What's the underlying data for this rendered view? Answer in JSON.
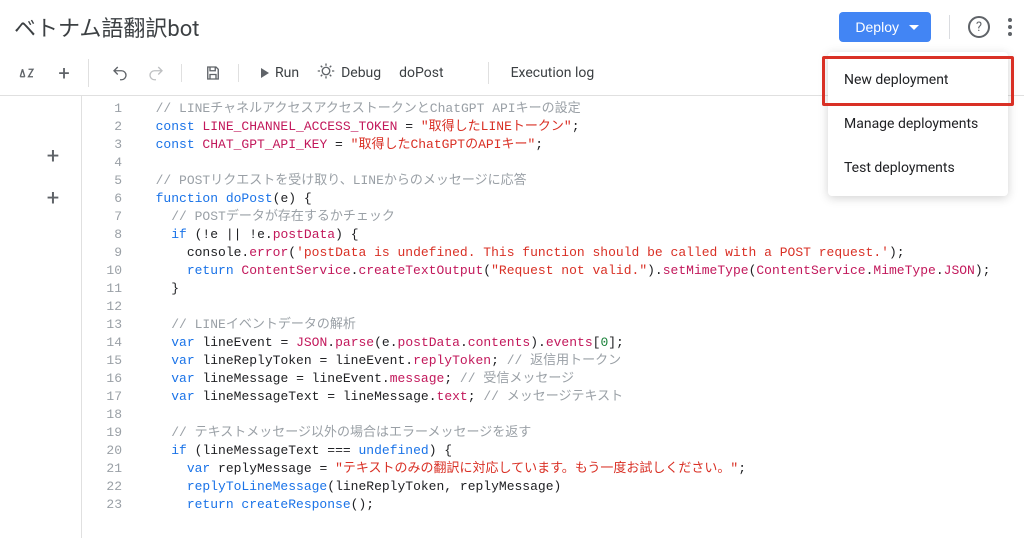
{
  "header": {
    "title": "ベトナム語翻訳bot",
    "deploy_label": "Deploy"
  },
  "deploy_menu": {
    "items": [
      {
        "label": "New deployment",
        "highlighted": true
      },
      {
        "label": "Manage deployments",
        "highlighted": false
      },
      {
        "label": "Test deployments",
        "highlighted": false
      }
    ]
  },
  "toolbar": {
    "run": "Run",
    "debug": "Debug",
    "func": "doPost",
    "exec_log": "Execution log"
  },
  "code_lines": [
    {
      "n": 1,
      "tokens": [
        [
          "  ",
          ""
        ],
        [
          "// LINEチャネルアクセスアクセストークンとChatGPT APIキーの設定",
          "cm"
        ]
      ]
    },
    {
      "n": 2,
      "tokens": [
        [
          "  ",
          ""
        ],
        [
          "const ",
          "kw"
        ],
        [
          "LINE_CHANNEL_ACCESS_TOKEN",
          "prop"
        ],
        [
          " = ",
          ""
        ],
        [
          "\"取得したLINEトークン\"",
          "str"
        ],
        [
          ";",
          ""
        ]
      ]
    },
    {
      "n": 3,
      "tokens": [
        [
          "  ",
          ""
        ],
        [
          "const ",
          "kw"
        ],
        [
          "CHAT_GPT_API_KEY",
          "prop"
        ],
        [
          " = ",
          ""
        ],
        [
          "\"取得したChatGPTのAPIキー\"",
          "str"
        ],
        [
          ";",
          ""
        ]
      ]
    },
    {
      "n": 4,
      "tokens": [
        [
          "",
          ""
        ]
      ]
    },
    {
      "n": 5,
      "tokens": [
        [
          "  ",
          ""
        ],
        [
          "// POSTリクエストを受け取り、LINEからのメッセージに応答",
          "cm"
        ]
      ]
    },
    {
      "n": 6,
      "tokens": [
        [
          "  ",
          ""
        ],
        [
          "function ",
          "kw"
        ],
        [
          "doPost",
          "fn"
        ],
        [
          "(",
          ""
        ],
        [
          "e",
          "id"
        ],
        [
          ") {",
          ""
        ]
      ]
    },
    {
      "n": 7,
      "tokens": [
        [
          "    ",
          ""
        ],
        [
          "// POSTデータが存在するかチェック",
          "cm"
        ]
      ]
    },
    {
      "n": 8,
      "tokens": [
        [
          "    ",
          ""
        ],
        [
          "if ",
          "kw"
        ],
        [
          "(!",
          ""
        ],
        [
          "e",
          "id"
        ],
        [
          " || !",
          ""
        ],
        [
          "e",
          "id"
        ],
        [
          ".",
          ""
        ],
        [
          "postData",
          "prop"
        ],
        [
          ") {",
          ""
        ]
      ]
    },
    {
      "n": 9,
      "tokens": [
        [
          "      ",
          ""
        ],
        [
          "console",
          "id"
        ],
        [
          ".",
          ""
        ],
        [
          "error",
          "prop"
        ],
        [
          "(",
          ""
        ],
        [
          "'postData is undefined. This function should be called with a POST request.'",
          "str"
        ],
        [
          ");",
          ""
        ]
      ]
    },
    {
      "n": 10,
      "tokens": [
        [
          "      ",
          ""
        ],
        [
          "return ",
          "kw"
        ],
        [
          "ContentService",
          "obj"
        ],
        [
          ".",
          ""
        ],
        [
          "createTextOutput",
          "prop"
        ],
        [
          "(",
          ""
        ],
        [
          "\"Request not valid.\"",
          "str"
        ],
        [
          ").",
          ""
        ],
        [
          "setMimeType",
          "prop"
        ],
        [
          "(",
          ""
        ],
        [
          "ContentService",
          "obj"
        ],
        [
          ".",
          ""
        ],
        [
          "MimeType",
          "obj"
        ],
        [
          ".",
          ""
        ],
        [
          "JSON",
          "obj"
        ],
        [
          ");",
          ""
        ]
      ]
    },
    {
      "n": 11,
      "tokens": [
        [
          "    }",
          ""
        ]
      ]
    },
    {
      "n": 12,
      "tokens": [
        [
          "",
          ""
        ]
      ]
    },
    {
      "n": 13,
      "tokens": [
        [
          "    ",
          ""
        ],
        [
          "// LINEイベントデータの解析",
          "cm"
        ]
      ]
    },
    {
      "n": 14,
      "tokens": [
        [
          "    ",
          ""
        ],
        [
          "var ",
          "kw"
        ],
        [
          "lineEvent",
          "id"
        ],
        [
          " = ",
          ""
        ],
        [
          "JSON",
          "obj"
        ],
        [
          ".",
          ""
        ],
        [
          "parse",
          "prop"
        ],
        [
          "(",
          ""
        ],
        [
          "e",
          "id"
        ],
        [
          ".",
          ""
        ],
        [
          "postData",
          "prop"
        ],
        [
          ".",
          ""
        ],
        [
          "contents",
          "prop"
        ],
        [
          ").",
          ""
        ],
        [
          "events",
          "prop"
        ],
        [
          "[",
          ""
        ],
        [
          "0",
          "num"
        ],
        [
          "];",
          ""
        ]
      ]
    },
    {
      "n": 15,
      "tokens": [
        [
          "    ",
          ""
        ],
        [
          "var ",
          "kw"
        ],
        [
          "lineReplyToken",
          "id"
        ],
        [
          " = ",
          ""
        ],
        [
          "lineEvent",
          "id"
        ],
        [
          ".",
          ""
        ],
        [
          "replyToken",
          "prop"
        ],
        [
          "; ",
          ""
        ],
        [
          "// 返信用トークン",
          "cm"
        ]
      ]
    },
    {
      "n": 16,
      "tokens": [
        [
          "    ",
          ""
        ],
        [
          "var ",
          "kw"
        ],
        [
          "lineMessage",
          "id"
        ],
        [
          " = ",
          ""
        ],
        [
          "lineEvent",
          "id"
        ],
        [
          ".",
          ""
        ],
        [
          "message",
          "prop"
        ],
        [
          "; ",
          ""
        ],
        [
          "// 受信メッセージ",
          "cm"
        ]
      ]
    },
    {
      "n": 17,
      "tokens": [
        [
          "    ",
          ""
        ],
        [
          "var ",
          "kw"
        ],
        [
          "lineMessageText",
          "id"
        ],
        [
          " = ",
          ""
        ],
        [
          "lineMessage",
          "id"
        ],
        [
          ".",
          ""
        ],
        [
          "text",
          "prop"
        ],
        [
          "; ",
          ""
        ],
        [
          "// メッセージテキスト",
          "cm"
        ]
      ]
    },
    {
      "n": 18,
      "tokens": [
        [
          "",
          ""
        ]
      ]
    },
    {
      "n": 19,
      "tokens": [
        [
          "    ",
          ""
        ],
        [
          "// テキストメッセージ以外の場合はエラーメッセージを返す",
          "cm"
        ]
      ]
    },
    {
      "n": 20,
      "tokens": [
        [
          "    ",
          ""
        ],
        [
          "if ",
          "kw"
        ],
        [
          "(",
          ""
        ],
        [
          "lineMessageText",
          "id"
        ],
        [
          " === ",
          ""
        ],
        [
          "undefined",
          "kw"
        ],
        [
          ") {",
          ""
        ]
      ]
    },
    {
      "n": 21,
      "tokens": [
        [
          "      ",
          ""
        ],
        [
          "var ",
          "kw"
        ],
        [
          "replyMessage",
          "id"
        ],
        [
          " = ",
          ""
        ],
        [
          "\"テキストのみの翻訳に対応しています。もう一度お試しください。\"",
          "str"
        ],
        [
          ";",
          ""
        ]
      ]
    },
    {
      "n": 22,
      "tokens": [
        [
          "      ",
          ""
        ],
        [
          "replyToLineMessage",
          "fn"
        ],
        [
          "(",
          ""
        ],
        [
          "lineReplyToken",
          "id"
        ],
        [
          ", ",
          ""
        ],
        [
          "replyMessage",
          "id"
        ],
        [
          ")",
          ""
        ]
      ]
    },
    {
      "n": 23,
      "tokens": [
        [
          "      ",
          ""
        ],
        [
          "return ",
          "kw"
        ],
        [
          "createResponse",
          "fn"
        ],
        [
          "();",
          ""
        ]
      ]
    }
  ]
}
